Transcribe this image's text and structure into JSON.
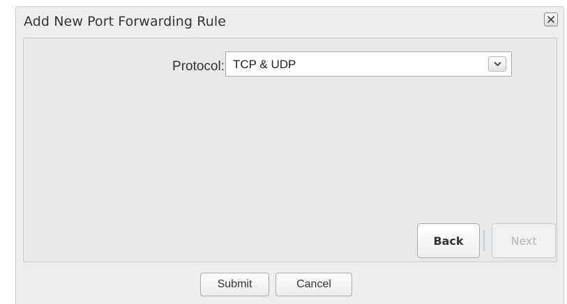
{
  "dialog": {
    "title": "Add New Port Forwarding Rule",
    "close_icon": "close-icon"
  },
  "form": {
    "protocol_label": "Protocol:",
    "protocol_value": "TCP & UDP",
    "dropdown_icon": "chevron-down-icon"
  },
  "wizard": {
    "back_label": "Back",
    "next_label": "Next",
    "next_disabled": true
  },
  "footer": {
    "submit_label": "Submit",
    "cancel_label": "Cancel"
  }
}
